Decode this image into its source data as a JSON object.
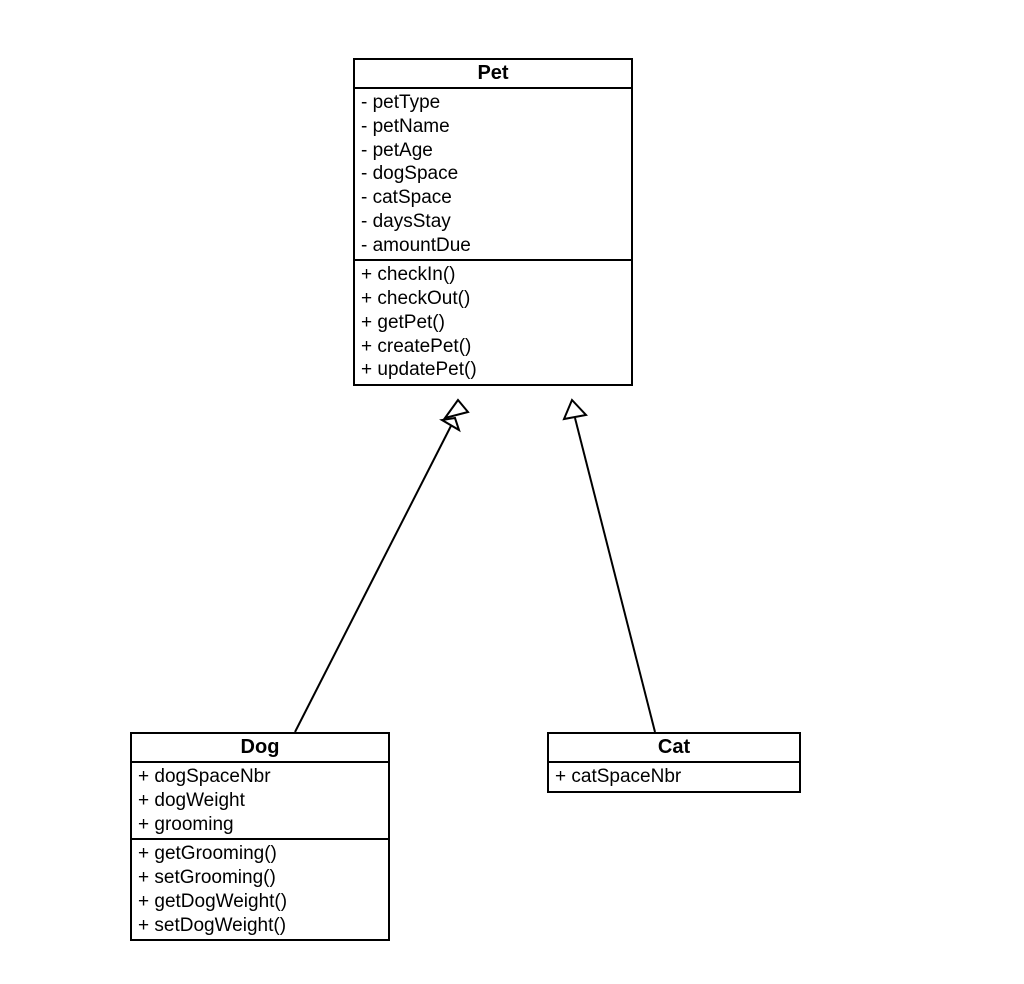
{
  "diagram": {
    "type": "uml-class",
    "classes": {
      "pet": {
        "name": "Pet",
        "attributes": [
          "- petType",
          "- petName",
          "- petAge",
          "- dogSpace",
          "- catSpace",
          "- daysStay",
          "- amountDue"
        ],
        "methods": [
          "+ checkIn()",
          "+ checkOut()",
          "+ getPet()",
          "+ createPet()",
          "+ updatePet()"
        ]
      },
      "dog": {
        "name": "Dog",
        "attributes": [
          "+ dogSpaceNbr",
          "+ dogWeight",
          "+ grooming"
        ],
        "methods": [
          "+ getGrooming()",
          "+ setGrooming()",
          "+ getDogWeight()",
          "+ setDogWeight()"
        ]
      },
      "cat": {
        "name": "Cat",
        "attributes": [
          "+ catSpaceNbr"
        ],
        "methods": []
      }
    },
    "relationships": [
      {
        "from": "dog",
        "to": "pet",
        "type": "generalization"
      },
      {
        "from": "cat",
        "to": "pet",
        "type": "generalization"
      }
    ]
  }
}
